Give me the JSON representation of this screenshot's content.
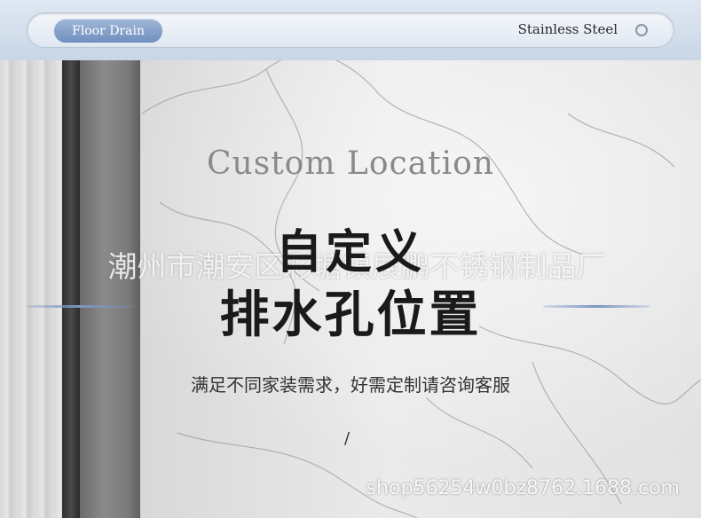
{
  "header": {
    "tag_label": "Floor Drain",
    "brand_label": "Stainless Steel",
    "ring_icon": "ring-icon",
    "accent": "#7d97c2"
  },
  "main": {
    "en_title": "Custom Location",
    "cn_title_line1": "自定义",
    "cn_title_line2": "排水孔位置",
    "watermark": "潮州市潮安区彩塘镇展鹏不锈钢制品厂",
    "subtitle": "满足不同家装需求，好需定制请咨询客服",
    "slash": "/",
    "shop_watermark": "shop56254w0bz8762.1688.com"
  }
}
